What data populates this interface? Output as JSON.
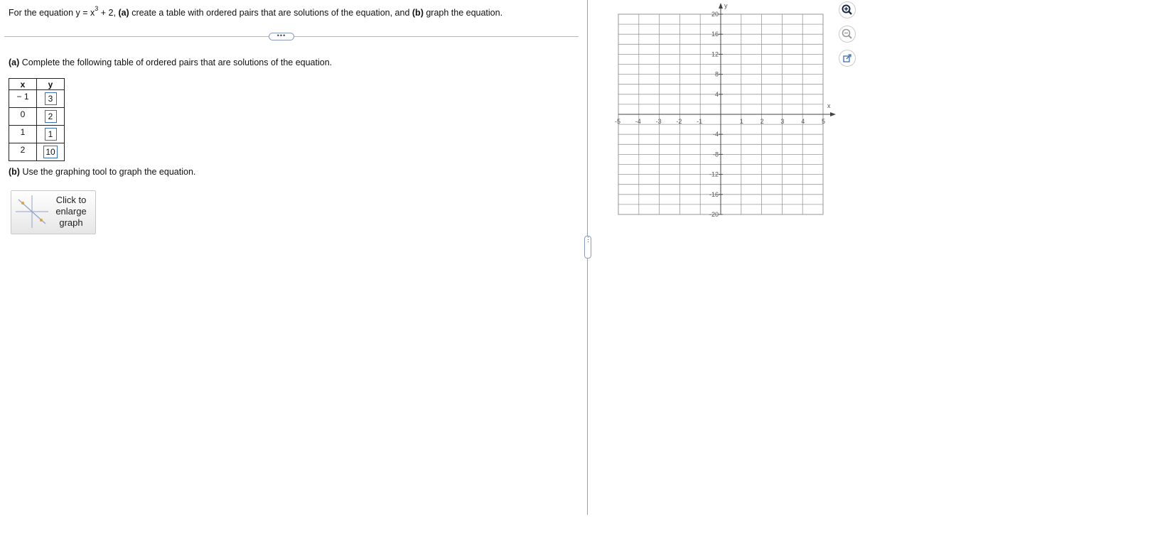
{
  "question": {
    "prefix": "For the equation y = x",
    "exponent": "3",
    "after_exponent": " + 2, ",
    "part_a_tag": "(a)",
    "part_a_text": " create a table with ordered pairs that are solutions of the equation, and ",
    "part_b_tag": "(b)",
    "part_b_text": " graph the equation."
  },
  "more_button": "•••",
  "part_a": {
    "tag": "(a)",
    "text": " Complete the following table of ordered pairs that are solutions of the equation."
  },
  "table": {
    "headers": {
      "x": "x",
      "y": "y"
    },
    "rows": [
      {
        "x": "− 1",
        "y": "3"
      },
      {
        "x": "0",
        "y": "2"
      },
      {
        "x": "1",
        "y": "1"
      },
      {
        "x": "2",
        "y": "10"
      }
    ]
  },
  "part_b": {
    "tag": "(b)",
    "text": " Use the graphing tool to graph the equation."
  },
  "enlarge_button": {
    "line1": "Click to",
    "line2": "enlarge",
    "line3": "graph"
  },
  "graph": {
    "x_axis_label": "x",
    "y_axis_label": "y",
    "x_range": [
      -5,
      5
    ],
    "y_range": [
      -20,
      20
    ],
    "x_ticks": [
      "-5",
      "-4",
      "-3",
      "-2",
      "-1",
      "1",
      "2",
      "3",
      "4",
      "5"
    ],
    "y_ticks": [
      "20",
      "16",
      "12",
      "8",
      "4",
      "-4",
      "-8",
      "-12",
      "-16",
      "-20"
    ],
    "minor_grid_y_step": 2
  },
  "tools": {
    "zoom_in": "zoom-in-icon",
    "zoom_out": "zoom-out-icon",
    "open_external": "external-link-icon"
  },
  "colors": {
    "accent": "#3a6fb0",
    "grid": "#9a9a9a"
  }
}
